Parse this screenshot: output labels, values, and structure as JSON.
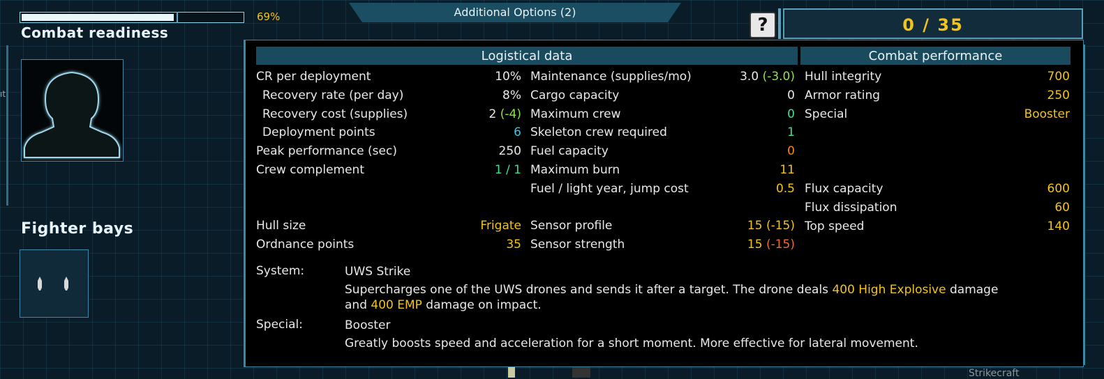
{
  "combat_readiness": {
    "label": "Combat readiness",
    "percent_text": "69%",
    "fill_fraction": 0.69
  },
  "fighter_bays": {
    "label": "Fighter bays",
    "slots": 1
  },
  "additional_options": {
    "label": "Additional Options",
    "count": "(2)"
  },
  "help_icon": {
    "glyph": "?"
  },
  "counter": {
    "text": "0 / 35"
  },
  "headers": {
    "logistical": "Logistical data",
    "combat": "Combat performance"
  },
  "col1": [
    {
      "label": "CR per deployment",
      "value": "10%",
      "color": "w",
      "indent": false
    },
    {
      "label": "Recovery rate (per day)",
      "value": "8%",
      "color": "w",
      "indent": true
    },
    {
      "label": "Recovery cost (supplies)",
      "value": "2",
      "value_extra": "(-4)",
      "color": "w",
      "extra_color": "lg",
      "indent": true
    },
    {
      "label": "Deployment points",
      "value": "6",
      "color": "c",
      "indent": true
    },
    {
      "label": "Peak performance (sec)",
      "value": "250",
      "color": "w",
      "indent": false
    },
    {
      "label": "Crew complement",
      "value": "1 / 1",
      "color": "g",
      "indent": false
    }
  ],
  "col1_lower": [
    {
      "label": "Hull size",
      "value": "Frigate",
      "color": "y"
    },
    {
      "label": "Ordnance points",
      "value": "35",
      "color": "y"
    }
  ],
  "col2": [
    {
      "label": "Maintenance (supplies/mo)",
      "value": "3.0",
      "value_extra": "(-3.0)",
      "color": "w",
      "extra_color": "lg"
    },
    {
      "label": "Cargo capacity",
      "value": "0",
      "color": "w"
    },
    {
      "label": "Maximum crew",
      "value": "0",
      "color": "g"
    },
    {
      "label": "Skeleton crew required",
      "value": "1",
      "color": "g"
    },
    {
      "label": "Fuel capacity",
      "value": "0",
      "color": "o"
    },
    {
      "label": "Maximum burn",
      "value": "11",
      "color": "y"
    },
    {
      "label": "Fuel / light year, jump cost",
      "value": "0.5",
      "color": "y"
    }
  ],
  "col2_lower": [
    {
      "label": "Sensor profile",
      "value": "15",
      "value_extra": "(-15)",
      "color": "y",
      "extra_color": "y"
    },
    {
      "label": "Sensor strength",
      "value": "15",
      "value_extra": "(-15)",
      "color": "y",
      "extra_color": "r"
    }
  ],
  "col3": [
    {
      "label": "Hull integrity",
      "value": "700",
      "color": "y"
    },
    {
      "label": "Armor rating",
      "value": "250",
      "color": "y"
    },
    {
      "label": "Special",
      "value": "Booster",
      "color": "y"
    }
  ],
  "col3_lower": [
    {
      "label": "Flux capacity",
      "value": "600",
      "color": "y"
    },
    {
      "label": "Flux dissipation",
      "value": "60",
      "color": "y"
    },
    {
      "label": "Top speed",
      "value": "140",
      "color": "y"
    }
  ],
  "system": {
    "label": "System:",
    "name": "UWS Strike",
    "desc_part1": "Supercharges one of the UWS drones and sends it after a target. The drone deals ",
    "desc_hl1": "400 High Explosive",
    "desc_part2": " damage",
    "desc_line2_hl": "400 EMP",
    "desc_line2_pre": "and ",
    "desc_line2_post": " damage on impact."
  },
  "special": {
    "label": "Special:",
    "name": "Booster",
    "desc": "Greatly boosts speed and acceleration for a short moment. More effective for lateral movement."
  },
  "edge_text": "ıt",
  "bottom_text": "Strikecraft"
}
